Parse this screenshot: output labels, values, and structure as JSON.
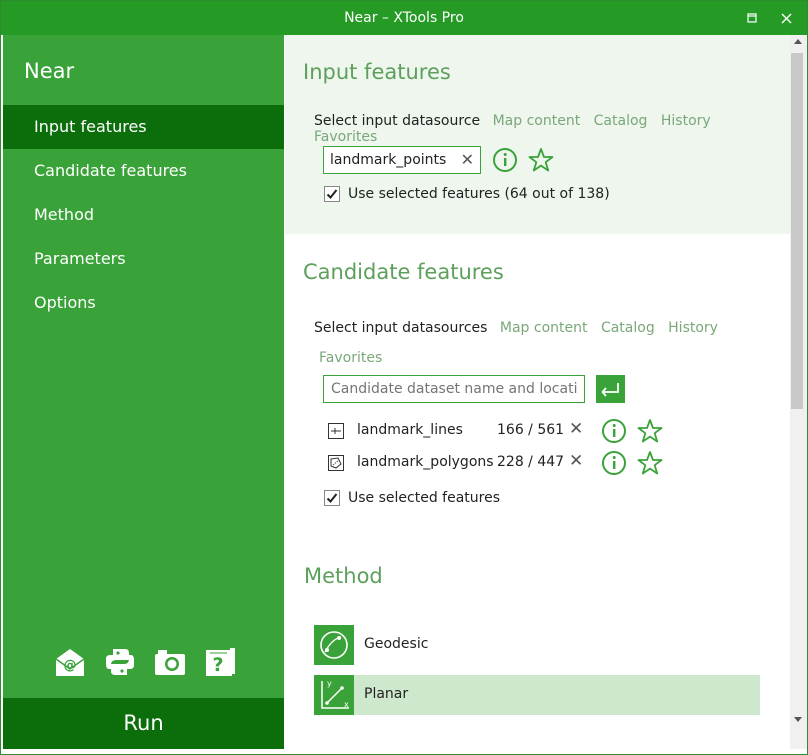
{
  "window": {
    "title": "Near – XTools Pro",
    "restore_icon": "restore-icon",
    "close_icon": "close-icon"
  },
  "sidebar": {
    "app_title": "Near",
    "items": [
      {
        "label": "Input features",
        "active": true
      },
      {
        "label": "Candidate features",
        "active": false
      },
      {
        "label": "Method",
        "active": false
      },
      {
        "label": "Parameters",
        "active": false
      },
      {
        "label": "Options",
        "active": false
      }
    ],
    "footer_icons": [
      "email-icon",
      "python-icon",
      "camera-icon",
      "help-icon"
    ],
    "run_label": "Run"
  },
  "input_features": {
    "heading": "Input features",
    "datasource_label": "Select input datasource",
    "links": [
      "Map content",
      "Catalog",
      "History",
      "Favorites"
    ],
    "field_value": "landmark_points",
    "use_selected": {
      "checked": true,
      "label": "Use selected features (64 out of 138)"
    }
  },
  "candidate_features": {
    "heading": "Candidate features",
    "datasource_label": "Select input datasources",
    "links": [
      "Map content",
      "Catalog",
      "History",
      "Favorites"
    ],
    "input_placeholder": "Candidate dataset name and location",
    "layers": [
      {
        "name": "landmark_lines",
        "count": "166 / 561",
        "icon": "line-layer-icon"
      },
      {
        "name": "landmark_polygons",
        "count": "228 / 447",
        "icon": "polygon-layer-icon"
      }
    ],
    "use_selected": {
      "checked": true,
      "label": "Use selected features"
    }
  },
  "method": {
    "heading": "Method",
    "options": [
      {
        "label": "Geodesic",
        "icon": "geodesic-icon",
        "selected": false
      },
      {
        "label": "Planar",
        "icon": "planar-icon",
        "selected": true
      }
    ]
  },
  "colors": {
    "accent": "#39a339",
    "dark_accent": "#0b6e0b",
    "heading": "#5ca05c",
    "link": "#7aa87a",
    "section_bg": "#eef6ee",
    "selected_bg": "#cde8cd"
  }
}
